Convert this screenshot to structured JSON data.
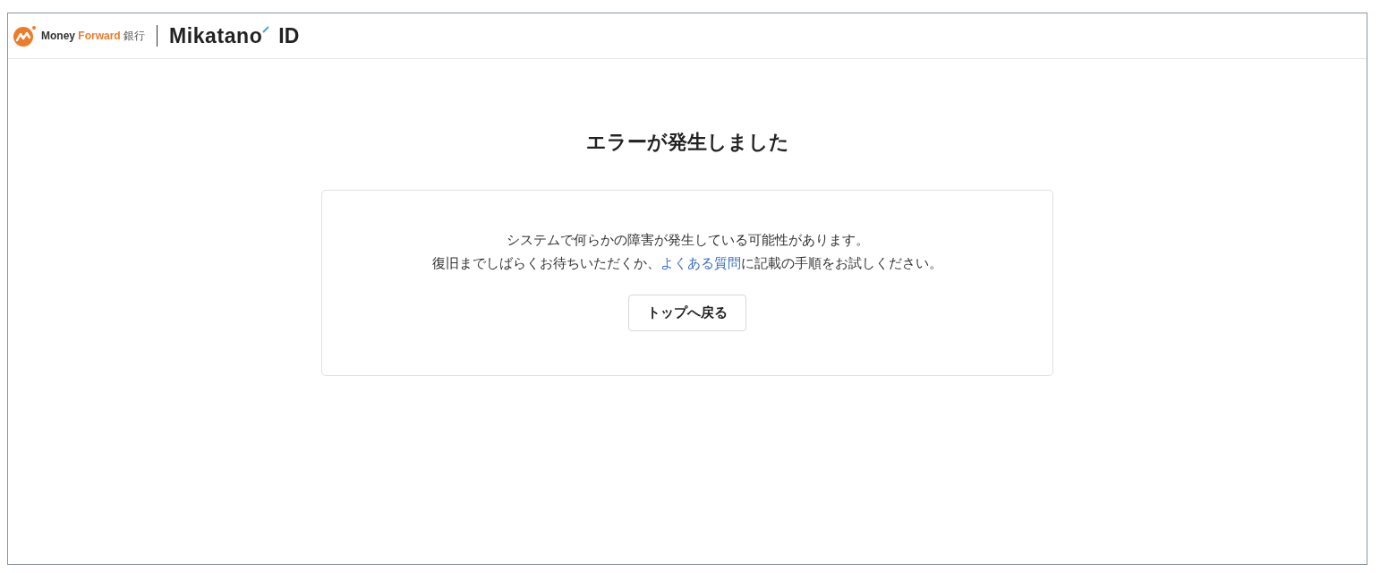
{
  "header": {
    "logo": {
      "brand": "Money",
      "brand_accent": "Forward",
      "suffix": "銀行"
    },
    "product": {
      "name": "Mikatano",
      "suffix": "ID"
    }
  },
  "error": {
    "title": "エラーが発生しました",
    "message": {
      "line_1": "システムで何らかの障害が発生している可能性があります。",
      "line_2_before": "復旧までしばらくお待ちいただくか、",
      "link": "よくある質問",
      "line_2_after": "に記載の手順をお試しください。"
    },
    "button": "トップへ戻る"
  }
}
